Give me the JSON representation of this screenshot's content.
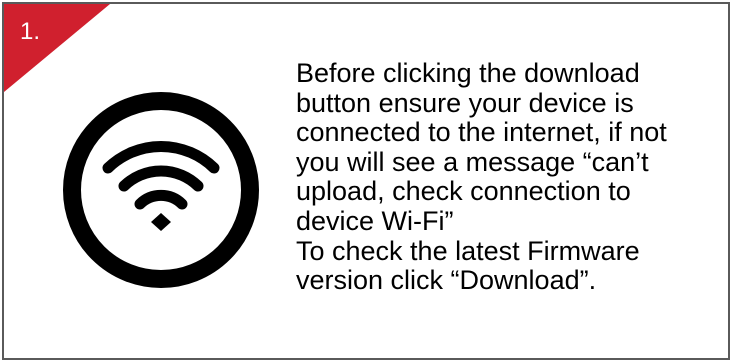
{
  "step": {
    "number": "1.",
    "corner_color": "#d0202e"
  },
  "icon": {
    "name": "wifi-icon",
    "color": "#000000"
  },
  "instructions": {
    "paragraph_1": "Before clicking the download\nbutton ensure your device is\nconnected to the internet, if not\nyou will see a message “can’t\nupload, check connection to\ndevice Wi-Fi”",
    "paragraph_2": "To check the latest Firmware\nversion click “Download”."
  }
}
